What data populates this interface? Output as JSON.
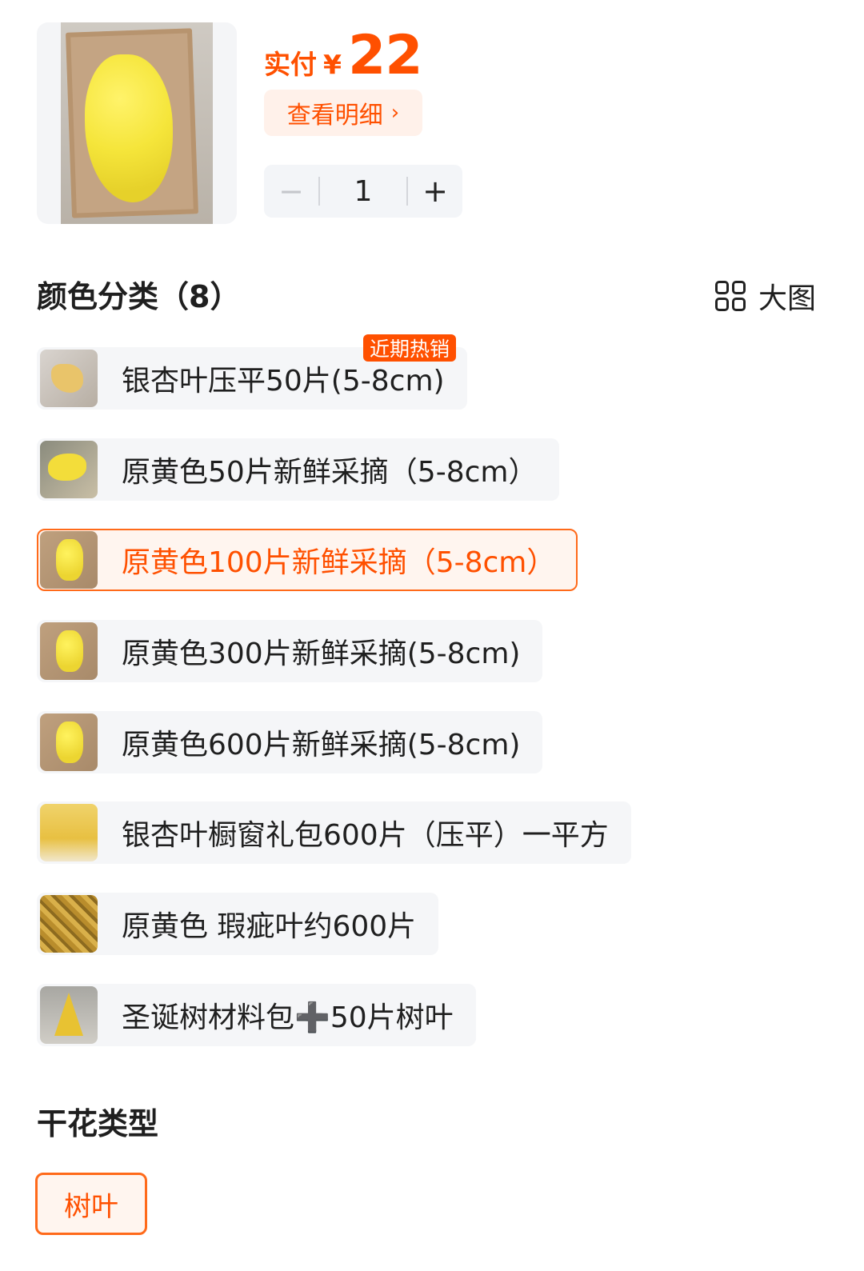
{
  "product": {
    "image_icon": "ginkgo-leaves-box-photo",
    "price_label": "实付",
    "currency": "¥",
    "price": "22",
    "detail_label": "查看明细",
    "detail_chevron": "›",
    "quantity": "1",
    "minus_label": "−",
    "plus_label": "+"
  },
  "color_section": {
    "title": "颜色分类（8）",
    "bigview_label": "大图",
    "hot_tag": "近期热销",
    "options": [
      {
        "label": "银杏叶压平50片(5-8cm)",
        "selected": false
      },
      {
        "label": "原黄色50片新鲜采摘（5-8cm）",
        "selected": false
      },
      {
        "label": "原黄色100片新鲜采摘（5-8cm）",
        "selected": true
      },
      {
        "label": "原黄色300片新鲜采摘(5-8cm)",
        "selected": false
      },
      {
        "label": "原黄色600片新鲜采摘(5-8cm)",
        "selected": false
      },
      {
        "label": "银杏叶橱窗礼包600片（压平）一平方",
        "selected": false
      },
      {
        "label": "原黄色 瑕疵叶约600片",
        "selected": false
      },
      {
        "label": "圣诞树材料包➕50片树叶",
        "selected": false
      }
    ]
  },
  "type_section": {
    "title": "干花类型",
    "options": [
      {
        "label": "树叶",
        "selected": true
      }
    ]
  },
  "colors": {
    "accent": "#ff5000",
    "selected_border": "#ff6a1a",
    "option_bg": "#f5f6f8"
  }
}
